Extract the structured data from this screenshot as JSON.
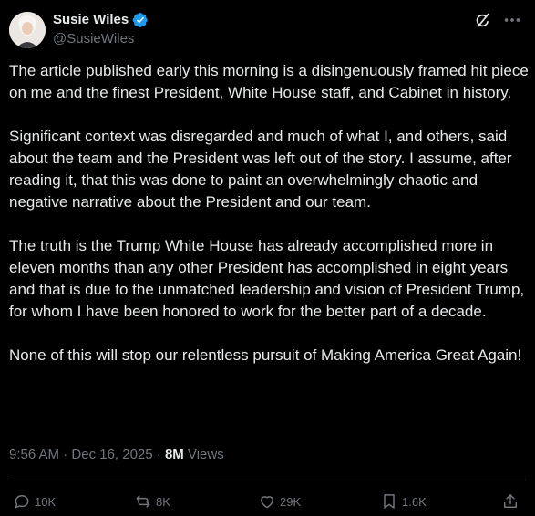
{
  "author": {
    "display_name": "Susie Wiles",
    "handle": "@SusieWiles",
    "verified_icon": "verified-badge-icon",
    "verified_color": "#1d9bf0"
  },
  "tweet": {
    "paragraphs": [
      "The article published early this morning is a disingenuously framed hit piece on me and the finest President, White House staff, and Cabinet in history.",
      "Significant context was disregarded and much of what I, and others, said about the team and the President was left out of the story. I assume, after reading it, that this was done to paint an overwhelmingly chaotic and negative narrative about the President and our team.",
      "The truth is the Trump White House has already accomplished more in eleven months than any other President has accomplished in eight years and that is due to the unmatched leadership and vision of President Trump, for whom I have been honored to work for the better part of a decade.",
      "None of this will stop our relentless pursuit of Making America Great Again!"
    ]
  },
  "meta": {
    "time": "9:56 AM",
    "separator": "·",
    "date": "Dec 16, 2025",
    "views_count": "8M",
    "views_label": "Views"
  },
  "actions": {
    "replies": "10K",
    "reposts": "8K",
    "likes": "29K",
    "bookmarks": "1.6K"
  },
  "colors": {
    "background": "#000000",
    "text": "#e7e9ea",
    "secondary": "#71767b",
    "divider": "#2f3336",
    "accent": "#1d9bf0"
  }
}
